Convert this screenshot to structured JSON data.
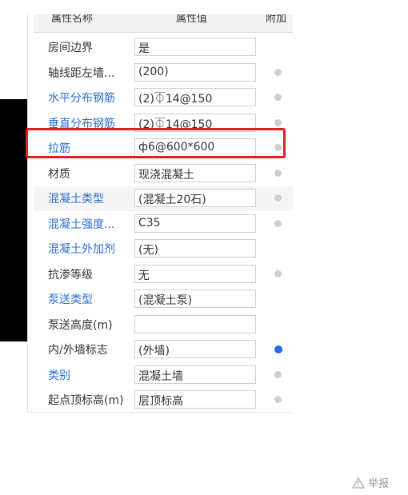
{
  "header": {
    "name_col": "属性名称",
    "value_col": "属性值",
    "extra_col": "附加"
  },
  "rows": [
    {
      "name": "房间边界",
      "value": "是",
      "link": false,
      "dot": "none"
    },
    {
      "name": "轴线距左墙...",
      "value": "(200)",
      "link": false,
      "dot": "gray"
    },
    {
      "name": "水平分布钢筋",
      "value": "(2)⏁14@150",
      "link": true,
      "dot": "gray"
    },
    {
      "name": "垂直分布钢筋",
      "value": "(2)⏁14@150",
      "link": true,
      "dot": "gray"
    },
    {
      "name": "拉筋",
      "value": "ф6@600*600",
      "link": true,
      "dot": "gray"
    },
    {
      "name": "材质",
      "value": "现浇混凝土",
      "link": false,
      "dot": "gray"
    },
    {
      "name": "混凝土类型",
      "value": "(混凝土20石)",
      "link": true,
      "dot": "gray"
    },
    {
      "name": "混凝土强度...",
      "value": "C35",
      "link": true,
      "dot": "gray"
    },
    {
      "name": "混凝土外加剂",
      "value": "(无)",
      "link": true,
      "dot": "none"
    },
    {
      "name": "抗渗等级",
      "value": "无",
      "link": false,
      "dot": "gray"
    },
    {
      "name": "泵送类型",
      "value": "(混凝土泵)",
      "link": true,
      "dot": "none"
    },
    {
      "name": "泵送高度(m)",
      "value": "",
      "link": false,
      "dot": "none"
    },
    {
      "name": "内/外墙标志",
      "value": "(外墙)",
      "link": false,
      "dot": "blue"
    },
    {
      "name": "类别",
      "value": "混凝土墙",
      "link": true,
      "dot": "gray"
    },
    {
      "name": "起点顶标高(m)",
      "value": "层顶标高",
      "link": false,
      "dot": "gray"
    }
  ],
  "footer": {
    "report_label": "举报"
  },
  "colors": {
    "link": "#2d6ed3",
    "highlight": "#e02020",
    "dot_active": "#1e6fe0"
  }
}
